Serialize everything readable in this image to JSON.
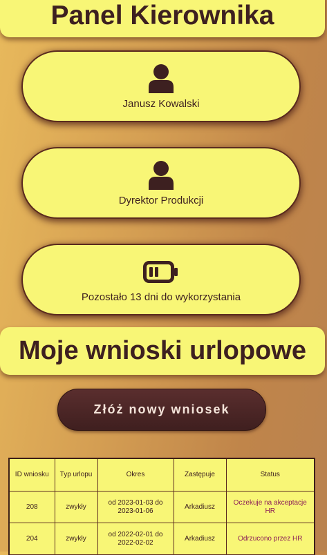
{
  "header": {
    "title": "Panel Kierownika"
  },
  "info_cards": [
    {
      "icon": "user-icon",
      "text": "Janusz Kowalski"
    },
    {
      "icon": "user-icon",
      "text": "Dyrektor Produkcji"
    },
    {
      "icon": "battery-icon",
      "text": "Pozostało 13 dni do wykorzystania"
    }
  ],
  "requests_section": {
    "title": "Moje wnioski urlopowe",
    "new_request_label": "Złóż nowy wniosek"
  },
  "requests_table": {
    "columns": [
      "ID wniosku",
      "Typ urlopu",
      "Okres",
      "Zastępuje",
      "Status"
    ],
    "rows": [
      {
        "id": "208",
        "type": "zwykły",
        "period": "od 2023-01-03 do 2023-01-06",
        "substitute": "Arkadiusz",
        "status": "Oczekuje na akceptacje HR"
      },
      {
        "id": "204",
        "type": "zwykły",
        "period": "od 2022-02-01 do 2022-02-02",
        "substitute": "Arkadiusz",
        "status": "Odrzucono przez HR"
      }
    ]
  },
  "colors": {
    "panel": "#f8f676",
    "text": "#3d2020",
    "button": "#4a2626",
    "status": "#8b1d57"
  }
}
